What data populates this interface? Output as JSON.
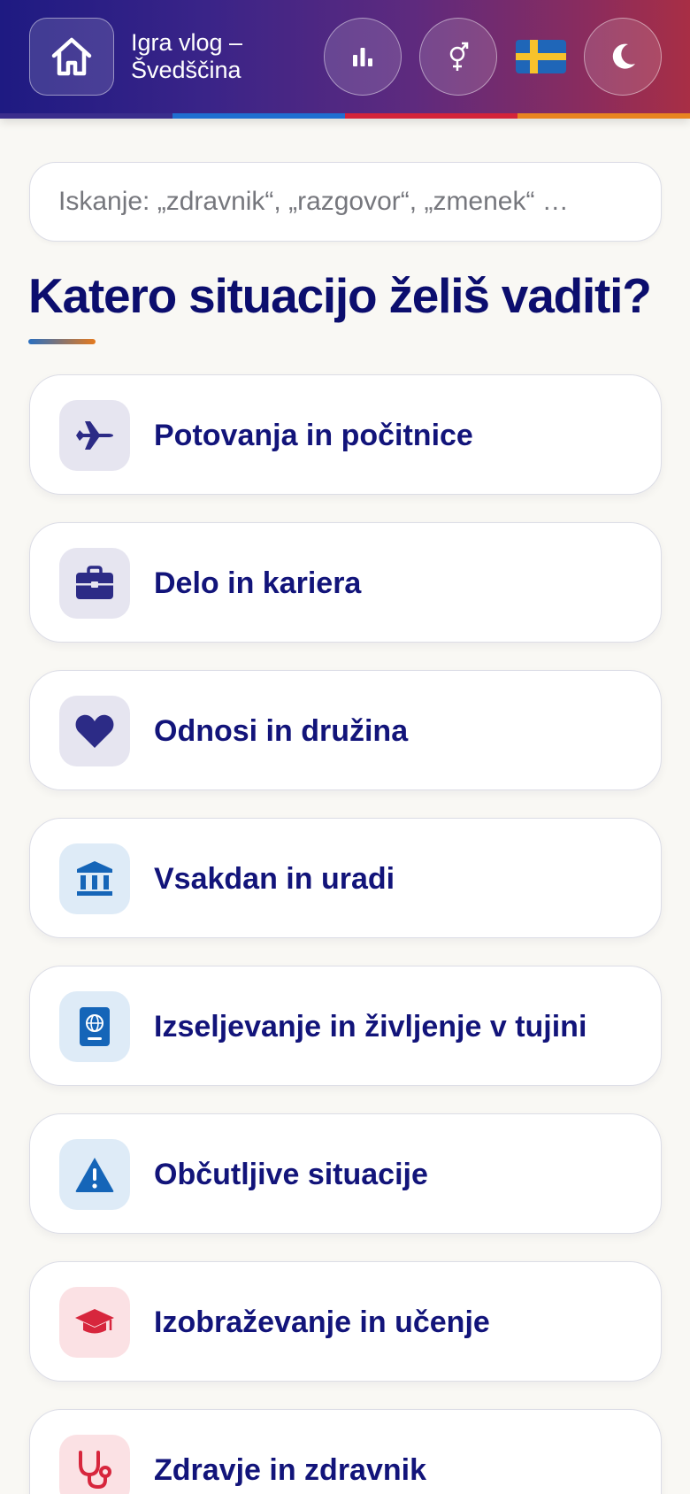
{
  "header": {
    "title": "Igra vlog – Švedščina",
    "home_icon": "home-icon",
    "stats_icon": "bar-chart-icon",
    "gender_icon": "gender-icon",
    "flag": "sweden-flag",
    "theme_icon": "moon-icon",
    "stripe_colors": [
      "#3a2d8c",
      "#1f6fd1",
      "#d4243a",
      "#e88420"
    ]
  },
  "search": {
    "placeholder": "Iskanje: „zdravnik“, „razgovor“, „zmenek“ …"
  },
  "main": {
    "heading": "Katero situacijo želiš vaditi?",
    "categories": [
      {
        "label": "Potovanja in počitnice",
        "icon": "airplane-icon"
      },
      {
        "label": "Delo in kariera",
        "icon": "briefcase-icon"
      },
      {
        "label": "Odnosi in družina",
        "icon": "heart-icon"
      },
      {
        "label": "Vsakdan in uradi",
        "icon": "bank-icon"
      },
      {
        "label": "Izseljevanje in življenje v tujini",
        "icon": "passport-icon"
      },
      {
        "label": "Občutljive situacije",
        "icon": "warning-icon"
      },
      {
        "label": "Izobraževanje in učenje",
        "icon": "graduation-cap-icon"
      },
      {
        "label": "Zdravje in zdravnik",
        "icon": "stethoscope-icon"
      }
    ]
  },
  "colors": {
    "heading": "#0c0e6e",
    "card_text": "#12147a",
    "icon_purple": "#2c2b86",
    "icon_blue": "#1565b8",
    "icon_red": "#d7263d",
    "tile_purple": "#e6e5f0",
    "tile_blue": "#deebf7",
    "tile_red": "#fbe1e4"
  }
}
